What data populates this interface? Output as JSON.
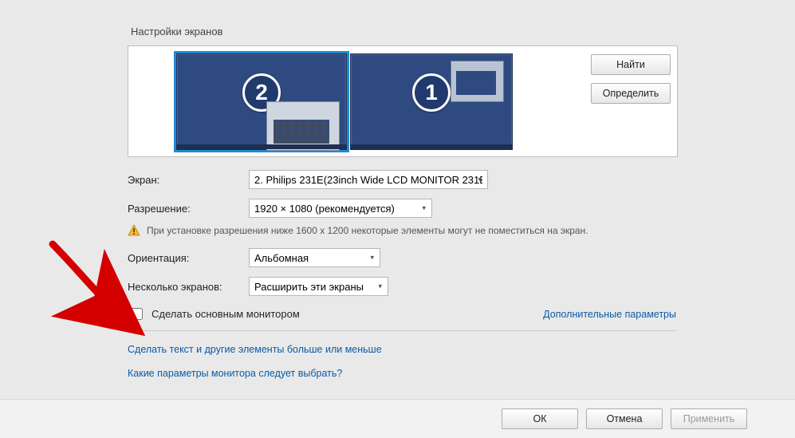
{
  "title": "Настройки экранов",
  "preview": {
    "monitors": [
      {
        "id": 2,
        "selected": true
      },
      {
        "id": 1,
        "selected": false
      }
    ],
    "buttons": {
      "find": "Найти",
      "identify": "Определить"
    }
  },
  "rows": {
    "screen_label": "Экран:",
    "screen_value": "2. Philips 231E(23inch Wide LCD MONITOR 231E",
    "resolution_label": "Разрешение:",
    "resolution_value": "1920 × 1080 (рекомендуется)",
    "warning": "При установке разрешения ниже 1600 x 1200 некоторые элементы могут не поместиться на экран.",
    "orientation_label": "Ориентация:",
    "orientation_value": "Альбомная",
    "multi_label": "Несколько экранов:",
    "multi_value": "Расширить эти экраны"
  },
  "primary": {
    "checkbox_label": "Сделать основным монитором",
    "advanced_link": "Дополнительные параметры"
  },
  "footer_links": {
    "text_size": "Сделать текст и другие элементы больше или меньше",
    "which_params": "Какие параметры монитора следует выбрать?"
  },
  "buttons": {
    "ok": "ОК",
    "cancel": "Отмена",
    "apply": "Применить"
  }
}
